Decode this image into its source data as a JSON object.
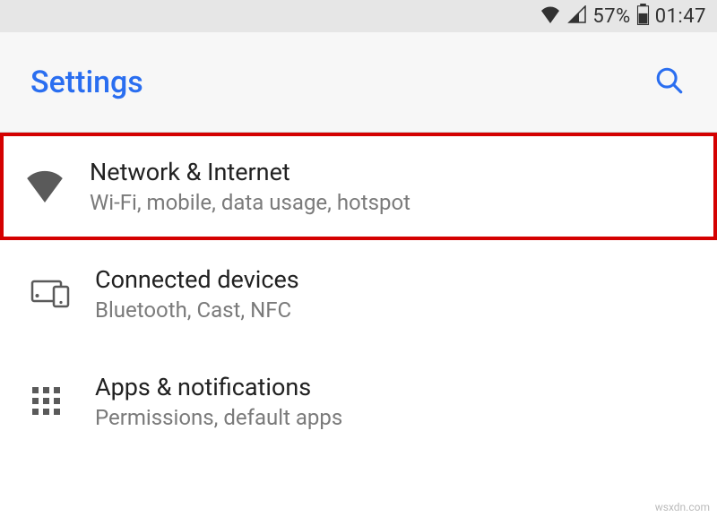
{
  "status_bar": {
    "battery_percent": "57%",
    "time": "01:47"
  },
  "app_bar": {
    "title": "Settings"
  },
  "items": [
    {
      "title": "Network & Internet",
      "subtitle": "Wi-Fi, mobile, data usage, hotspot",
      "highlighted": true
    },
    {
      "title": "Connected devices",
      "subtitle": "Bluetooth, Cast, NFC",
      "highlighted": false
    },
    {
      "title": "Apps & notifications",
      "subtitle": "Permissions, default apps",
      "highlighted": false
    }
  ],
  "watermark": "wsxdn.com"
}
